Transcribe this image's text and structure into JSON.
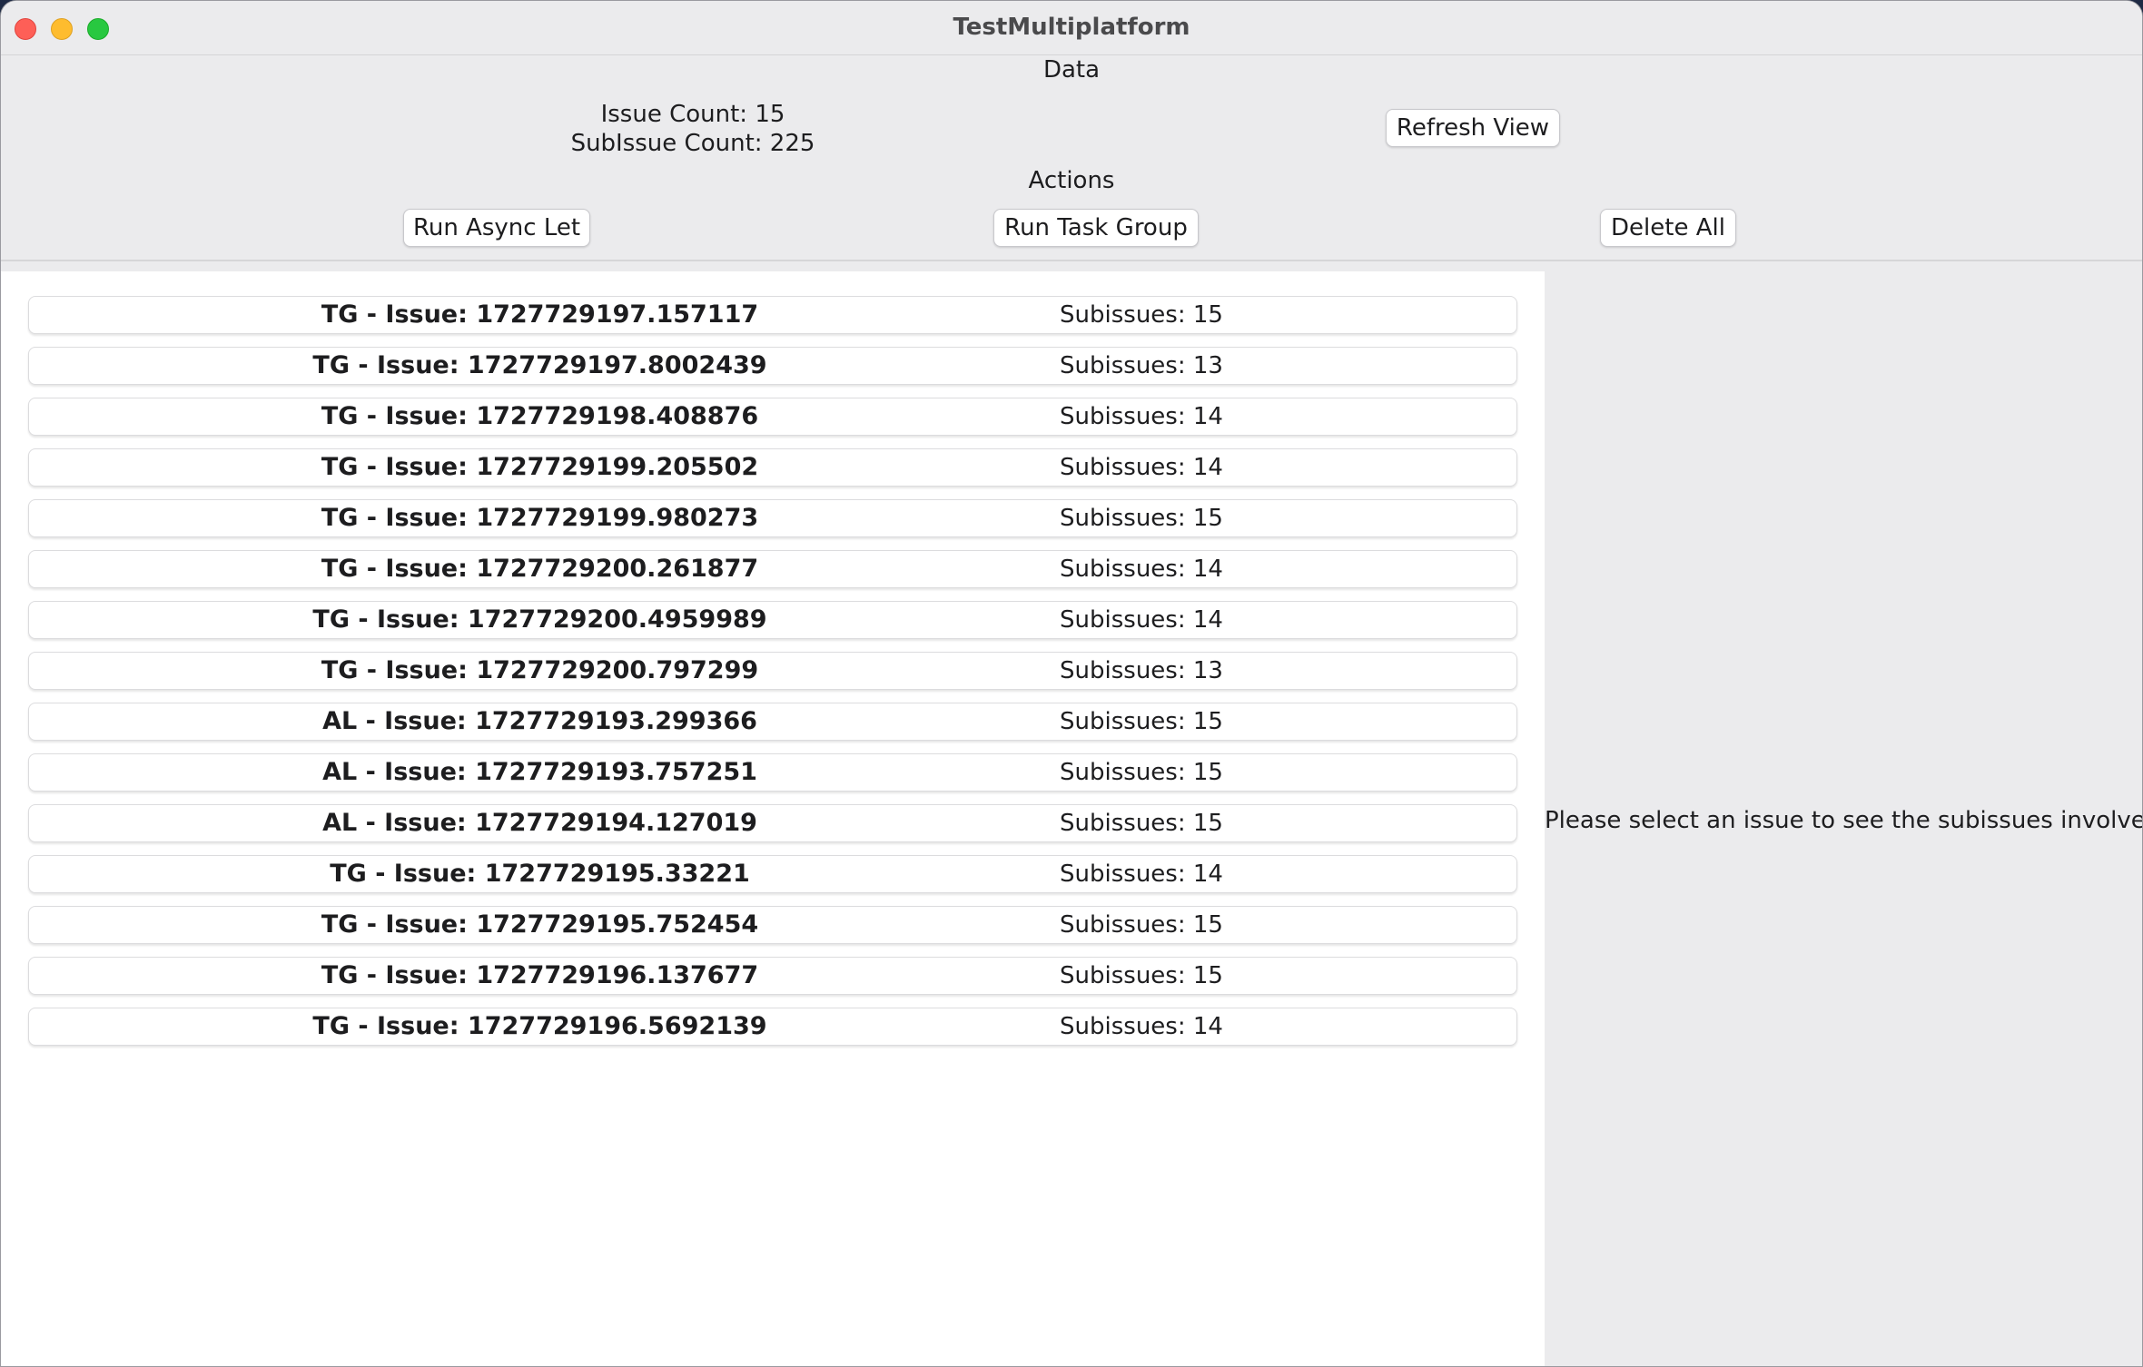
{
  "window": {
    "title": "TestMultiplatform"
  },
  "header": {
    "data_label": "Data",
    "issue_count": "Issue Count: 15",
    "subissue_count": "SubIssue Count: 225",
    "refresh_label": "Refresh View",
    "actions_label": "Actions",
    "run_async_let_label": "Run Async Let",
    "run_task_group_label": "Run Task Group",
    "delete_all_label": "Delete All"
  },
  "issues": [
    {
      "name": "TG - Issue: 1727729197.157117",
      "subissues": "Subissues: 15"
    },
    {
      "name": "TG - Issue: 1727729197.8002439",
      "subissues": "Subissues: 13"
    },
    {
      "name": "TG - Issue: 1727729198.408876",
      "subissues": "Subissues: 14"
    },
    {
      "name": "TG - Issue: 1727729199.205502",
      "subissues": "Subissues: 14"
    },
    {
      "name": "TG - Issue: 1727729199.980273",
      "subissues": "Subissues: 15"
    },
    {
      "name": "TG - Issue: 1727729200.261877",
      "subissues": "Subissues: 14"
    },
    {
      "name": "TG - Issue: 1727729200.4959989",
      "subissues": "Subissues: 14"
    },
    {
      "name": "TG - Issue: 1727729200.797299",
      "subissues": "Subissues: 13"
    },
    {
      "name": "AL - Issue: 1727729193.299366",
      "subissues": "Subissues: 15"
    },
    {
      "name": "AL - Issue: 1727729193.757251",
      "subissues": "Subissues: 15"
    },
    {
      "name": "AL - Issue: 1727729194.127019",
      "subissues": "Subissues: 15"
    },
    {
      "name": "TG - Issue: 1727729195.33221",
      "subissues": "Subissues: 14"
    },
    {
      "name": "TG - Issue: 1727729195.752454",
      "subissues": "Subissues: 15"
    },
    {
      "name": "TG - Issue: 1727729196.137677",
      "subissues": "Subissues: 15"
    },
    {
      "name": "TG - Issue: 1727729196.5692139",
      "subissues": "Subissues: 14"
    }
  ],
  "detail": {
    "placeholder": "Please select an issue to see the subissues involved."
  },
  "colors": {
    "close": "#fe5f57",
    "minimize": "#febc2e",
    "zoom": "#28c840",
    "chrome": "#ebebed",
    "list_background": "#ffffff"
  }
}
